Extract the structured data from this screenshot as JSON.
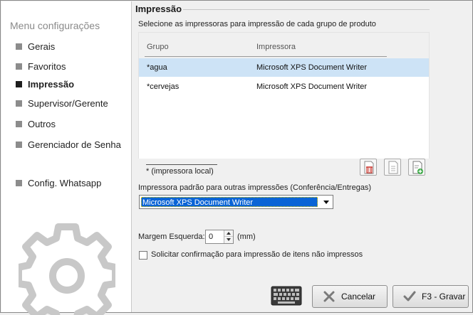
{
  "sidebar": {
    "title": "Menu configurações",
    "items": [
      {
        "label": "Gerais",
        "active": false
      },
      {
        "label": "Favoritos",
        "active": false
      },
      {
        "label": "Impressão",
        "active": true
      },
      {
        "label": "Supervisor/Gerente",
        "active": false
      },
      {
        "label": "Outros",
        "active": false
      },
      {
        "label": "Gerenciador de Senha",
        "active": false
      },
      {
        "label": "Config. Whatsapp",
        "active": false
      }
    ],
    "logo_icon": "gear-icon"
  },
  "section": {
    "title": "Impressão",
    "description": "Selecione as impressoras para impressão de cada  grupo de produto"
  },
  "grid": {
    "columns": [
      "Grupo",
      "Impressora"
    ],
    "rows": [
      {
        "grupo": "*agua",
        "impressora": "Microsoft XPS Document Writer",
        "selected": true
      },
      {
        "grupo": "*cervejas",
        "impressora": "Microsoft XPS Document Writer",
        "selected": false
      }
    ],
    "legend": "* (impressora local)"
  },
  "toolbar": {
    "delete_icon": "trash-icon",
    "edit_icon": "document-icon",
    "add_icon": "document-add-icon"
  },
  "default_printer": {
    "label": "Impressora padrão para outras impressões (Conferência/Entregas)",
    "value": "Microsoft XPS Document Writer"
  },
  "margin": {
    "label": "Margem Esquerda:",
    "value": "0",
    "unit": "(mm)"
  },
  "confirm_print": {
    "label": "Solicitar confirmação para impressão de itens não impressos",
    "checked": false
  },
  "footer": {
    "keyboard_icon": "keyboard-icon",
    "cancel_label": "Cancelar",
    "save_label": "F3 - Gravar"
  },
  "colors": {
    "selection": "#cde3f6",
    "dropdown_highlight": "#0a64d6"
  }
}
